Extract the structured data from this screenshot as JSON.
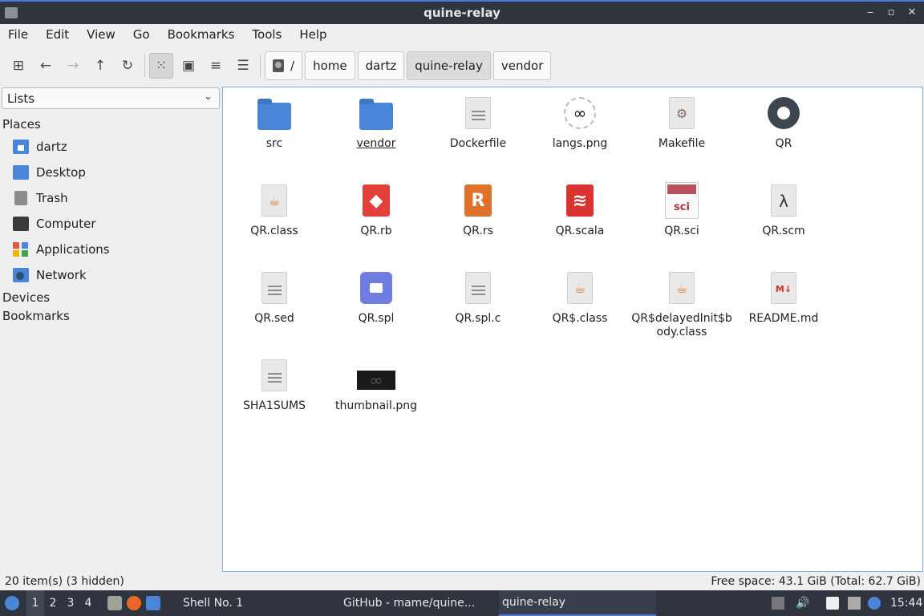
{
  "window": {
    "title": "quine-relay"
  },
  "menu": [
    "File",
    "Edit",
    "View",
    "Go",
    "Bookmarks",
    "Tools",
    "Help"
  ],
  "breadcrumbs": {
    "root": "/",
    "items": [
      "home",
      "dartz",
      "quine-relay",
      "vendor"
    ],
    "current": "quine-relay"
  },
  "sidebar": {
    "selector_value": "Lists",
    "places_heading": "Places",
    "places": [
      "dartz",
      "Desktop",
      "Trash",
      "Computer",
      "Applications",
      "Network"
    ],
    "devices_heading": "Devices",
    "bookmarks_heading": "Bookmarks"
  },
  "files": [
    {
      "name": "src",
      "kind": "folder-icon"
    },
    {
      "name": "vendor",
      "kind": "folder-icon"
    },
    {
      "name": "Dockerfile",
      "kind": "text-file-icon"
    },
    {
      "name": "langs.png",
      "kind": "image-icon"
    },
    {
      "name": "Makefile",
      "kind": "makefile-icon"
    },
    {
      "name": "QR",
      "kind": "executable-gear-icon"
    },
    {
      "name": "QR.class",
      "kind": "java-class-icon"
    },
    {
      "name": "QR.rb",
      "kind": "ruby-icon"
    },
    {
      "name": "QR.rs",
      "kind": "rust-icon"
    },
    {
      "name": "QR.scala",
      "kind": "scala-icon"
    },
    {
      "name": "QR.sci",
      "kind": "scilab-icon"
    },
    {
      "name": "QR.scm",
      "kind": "scheme-lambda-icon"
    },
    {
      "name": "QR.sed",
      "kind": "text-file-icon"
    },
    {
      "name": "QR.spl",
      "kind": "video-icon"
    },
    {
      "name": "QR.spl.c",
      "kind": "text-file-icon"
    },
    {
      "name": "QR$.class",
      "kind": "java-class-icon"
    },
    {
      "name": "QR$delayedInit$body.class",
      "kind": "java-class-icon"
    },
    {
      "name": "README.md",
      "kind": "markdown-icon"
    },
    {
      "name": "SHA1SUMS",
      "kind": "text-file-icon"
    },
    {
      "name": "thumbnail.png",
      "kind": "image-thumbnail-icon"
    }
  ],
  "status": {
    "left": "20 item(s) (3 hidden)",
    "right": "Free space: 43.1 GiB (Total: 62.7 GiB)"
  },
  "taskbar": {
    "workspaces": [
      "1",
      "2",
      "3",
      "4"
    ],
    "tasks": [
      "Shell No. 1",
      "GitHub - mame/quine...",
      "quine-relay"
    ],
    "clock": "15:44"
  },
  "glyphs": {
    "lambda": "λ",
    "java": "☕",
    "infinity": "∞",
    "md": "M↓",
    "R": "R"
  }
}
